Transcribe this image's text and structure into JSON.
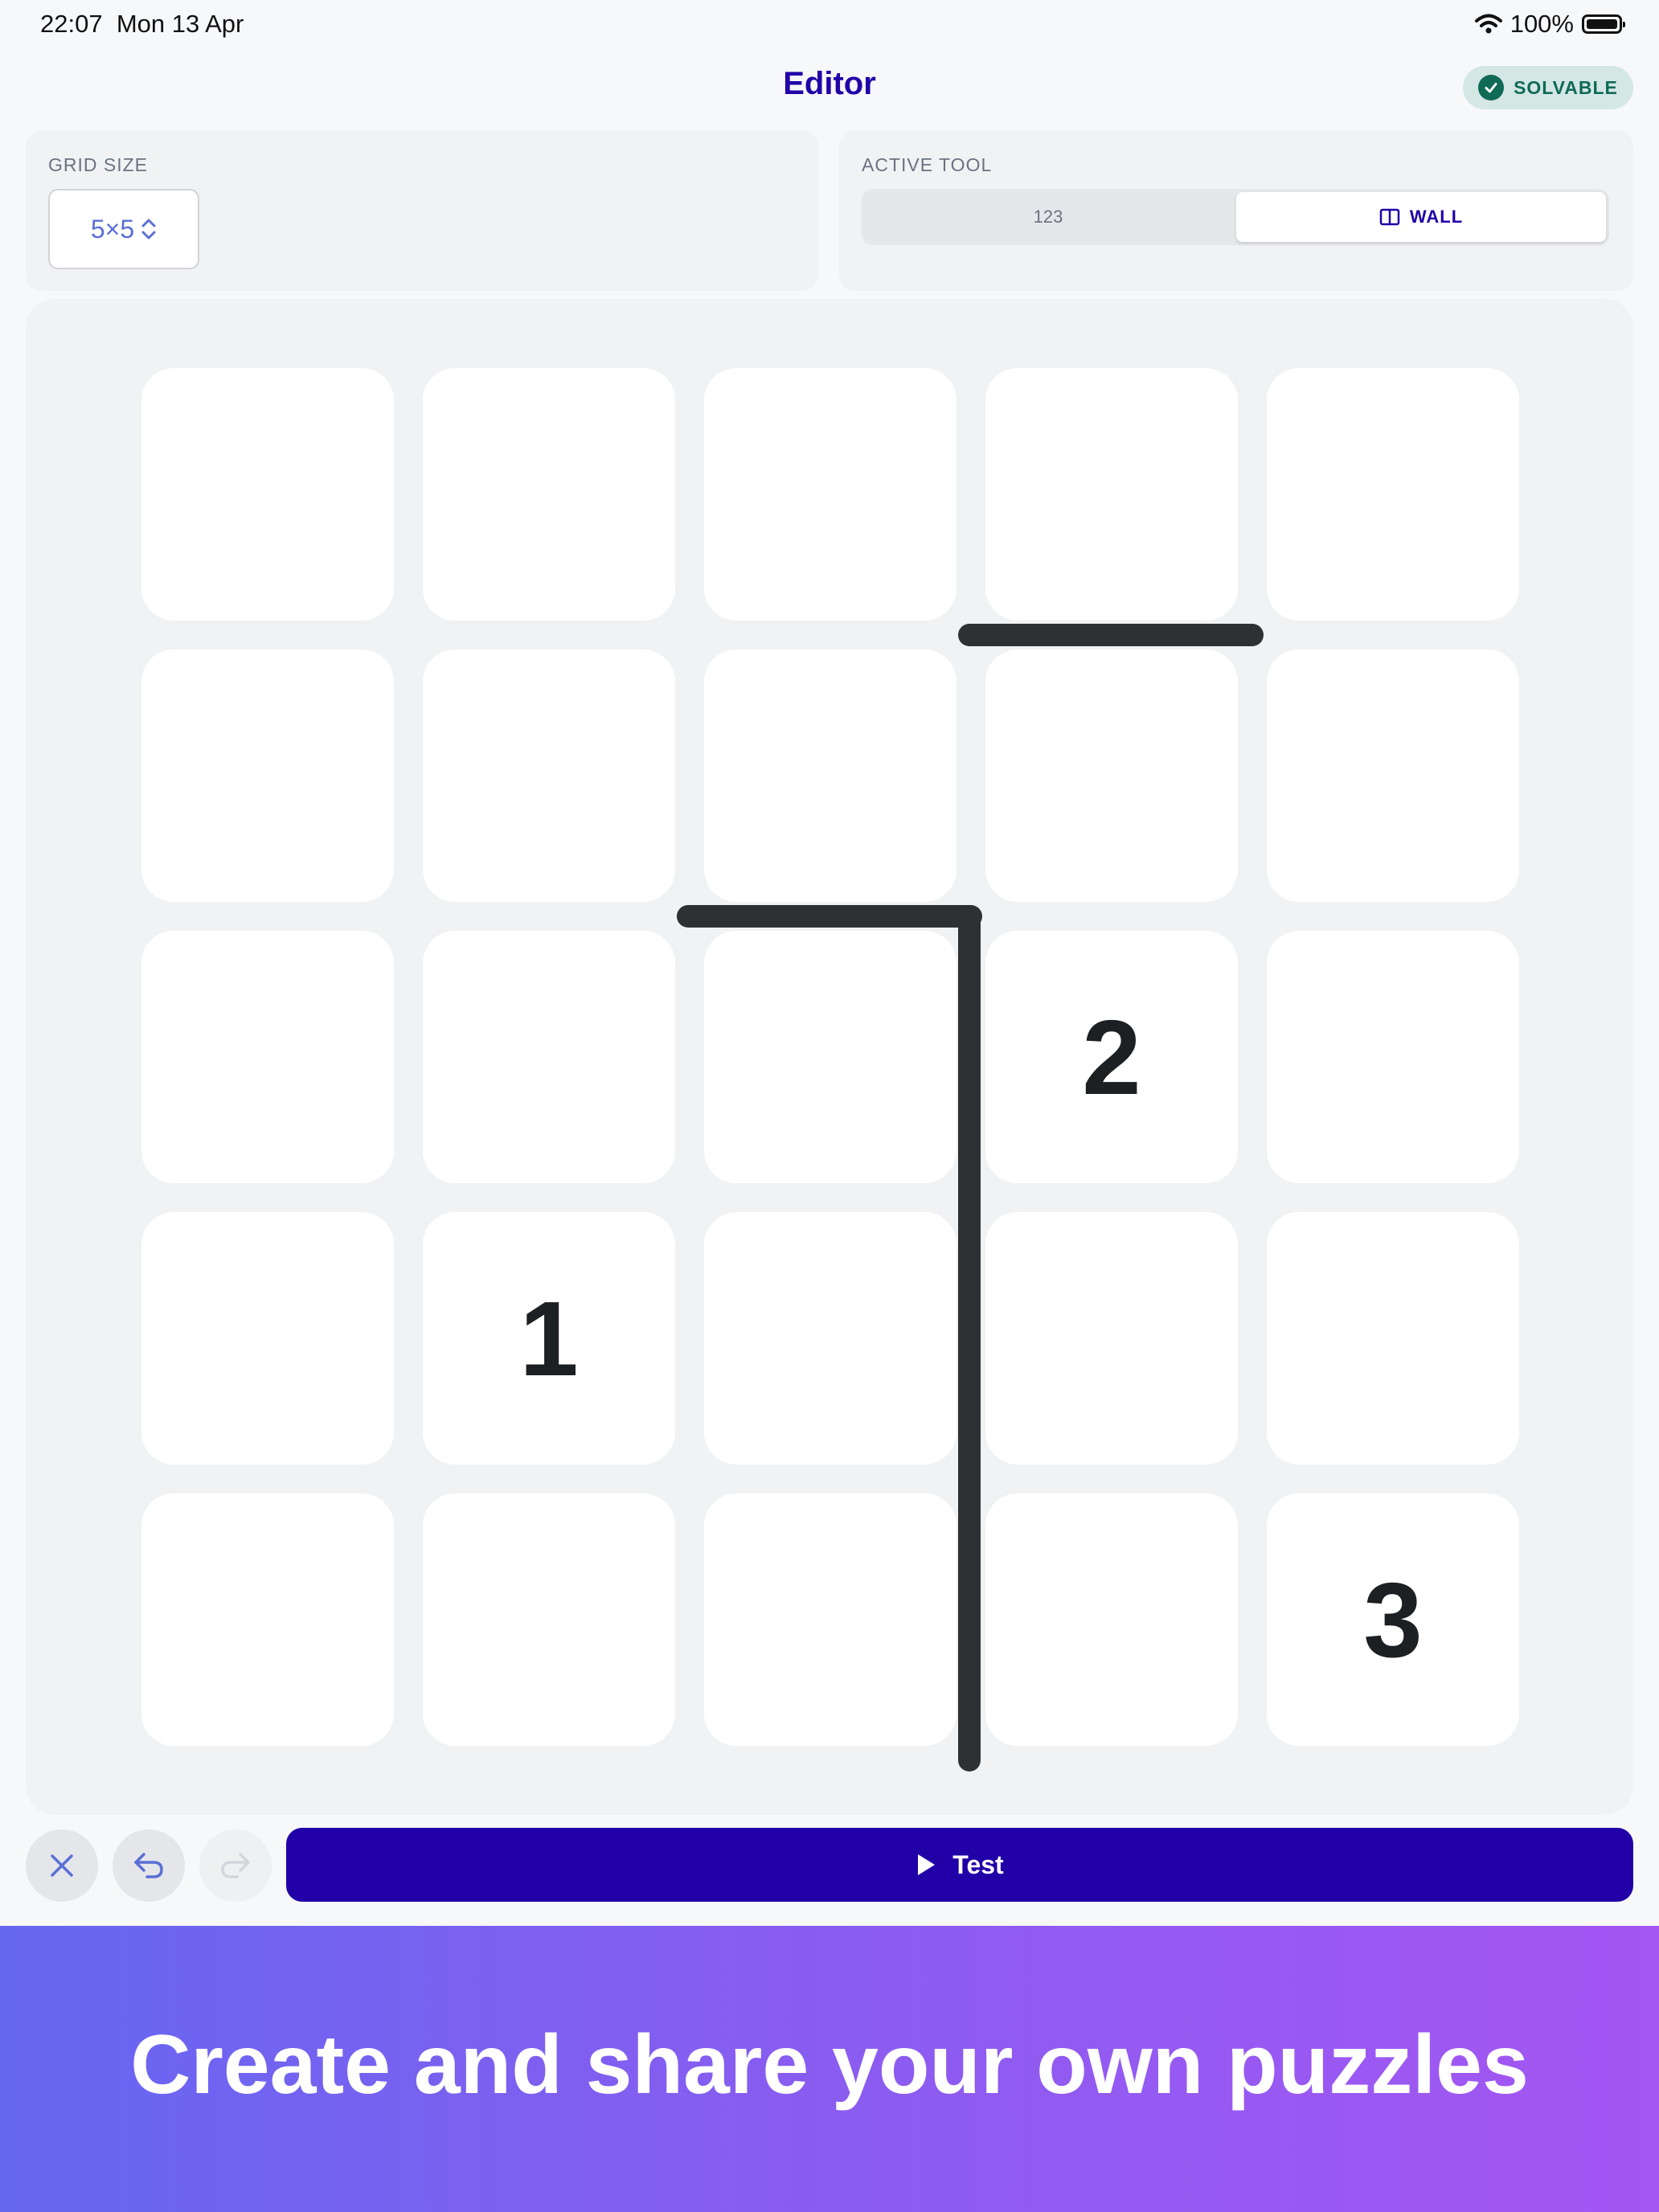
{
  "status_bar": {
    "time": "22:07",
    "date": "Mon 13 Apr",
    "battery": "100%"
  },
  "header": {
    "title": "Editor",
    "badge": "SOLVABLE"
  },
  "grid_size_panel": {
    "label": "GRID SIZE",
    "value": "5×5"
  },
  "tool_panel": {
    "label": "ACTIVE TOOL",
    "options": [
      "123",
      "WALL"
    ],
    "selected": "WALL"
  },
  "board": {
    "rows": 5,
    "cols": 5,
    "cells": [
      [
        "",
        "",
        "",
        "",
        ""
      ],
      [
        "",
        "",
        "",
        "",
        ""
      ],
      [
        "",
        "",
        "",
        "2",
        ""
      ],
      [
        "",
        "1",
        "",
        "",
        ""
      ],
      [
        "",
        "",
        "",
        "",
        "3"
      ]
    ]
  },
  "toolbar": {
    "test_label": "Test",
    "buttons": [
      "close-icon",
      "undo-icon",
      "redo-icon"
    ]
  },
  "banner": {
    "text": "Create and share your own puzzles"
  },
  "colors": {
    "accent": "#2100a8",
    "badge_bg": "#d4e7e4",
    "badge_fg": "#0f6a56",
    "wall": "#2e3134",
    "banner_start": "#6667f1",
    "banner_end": "#a556f3"
  }
}
